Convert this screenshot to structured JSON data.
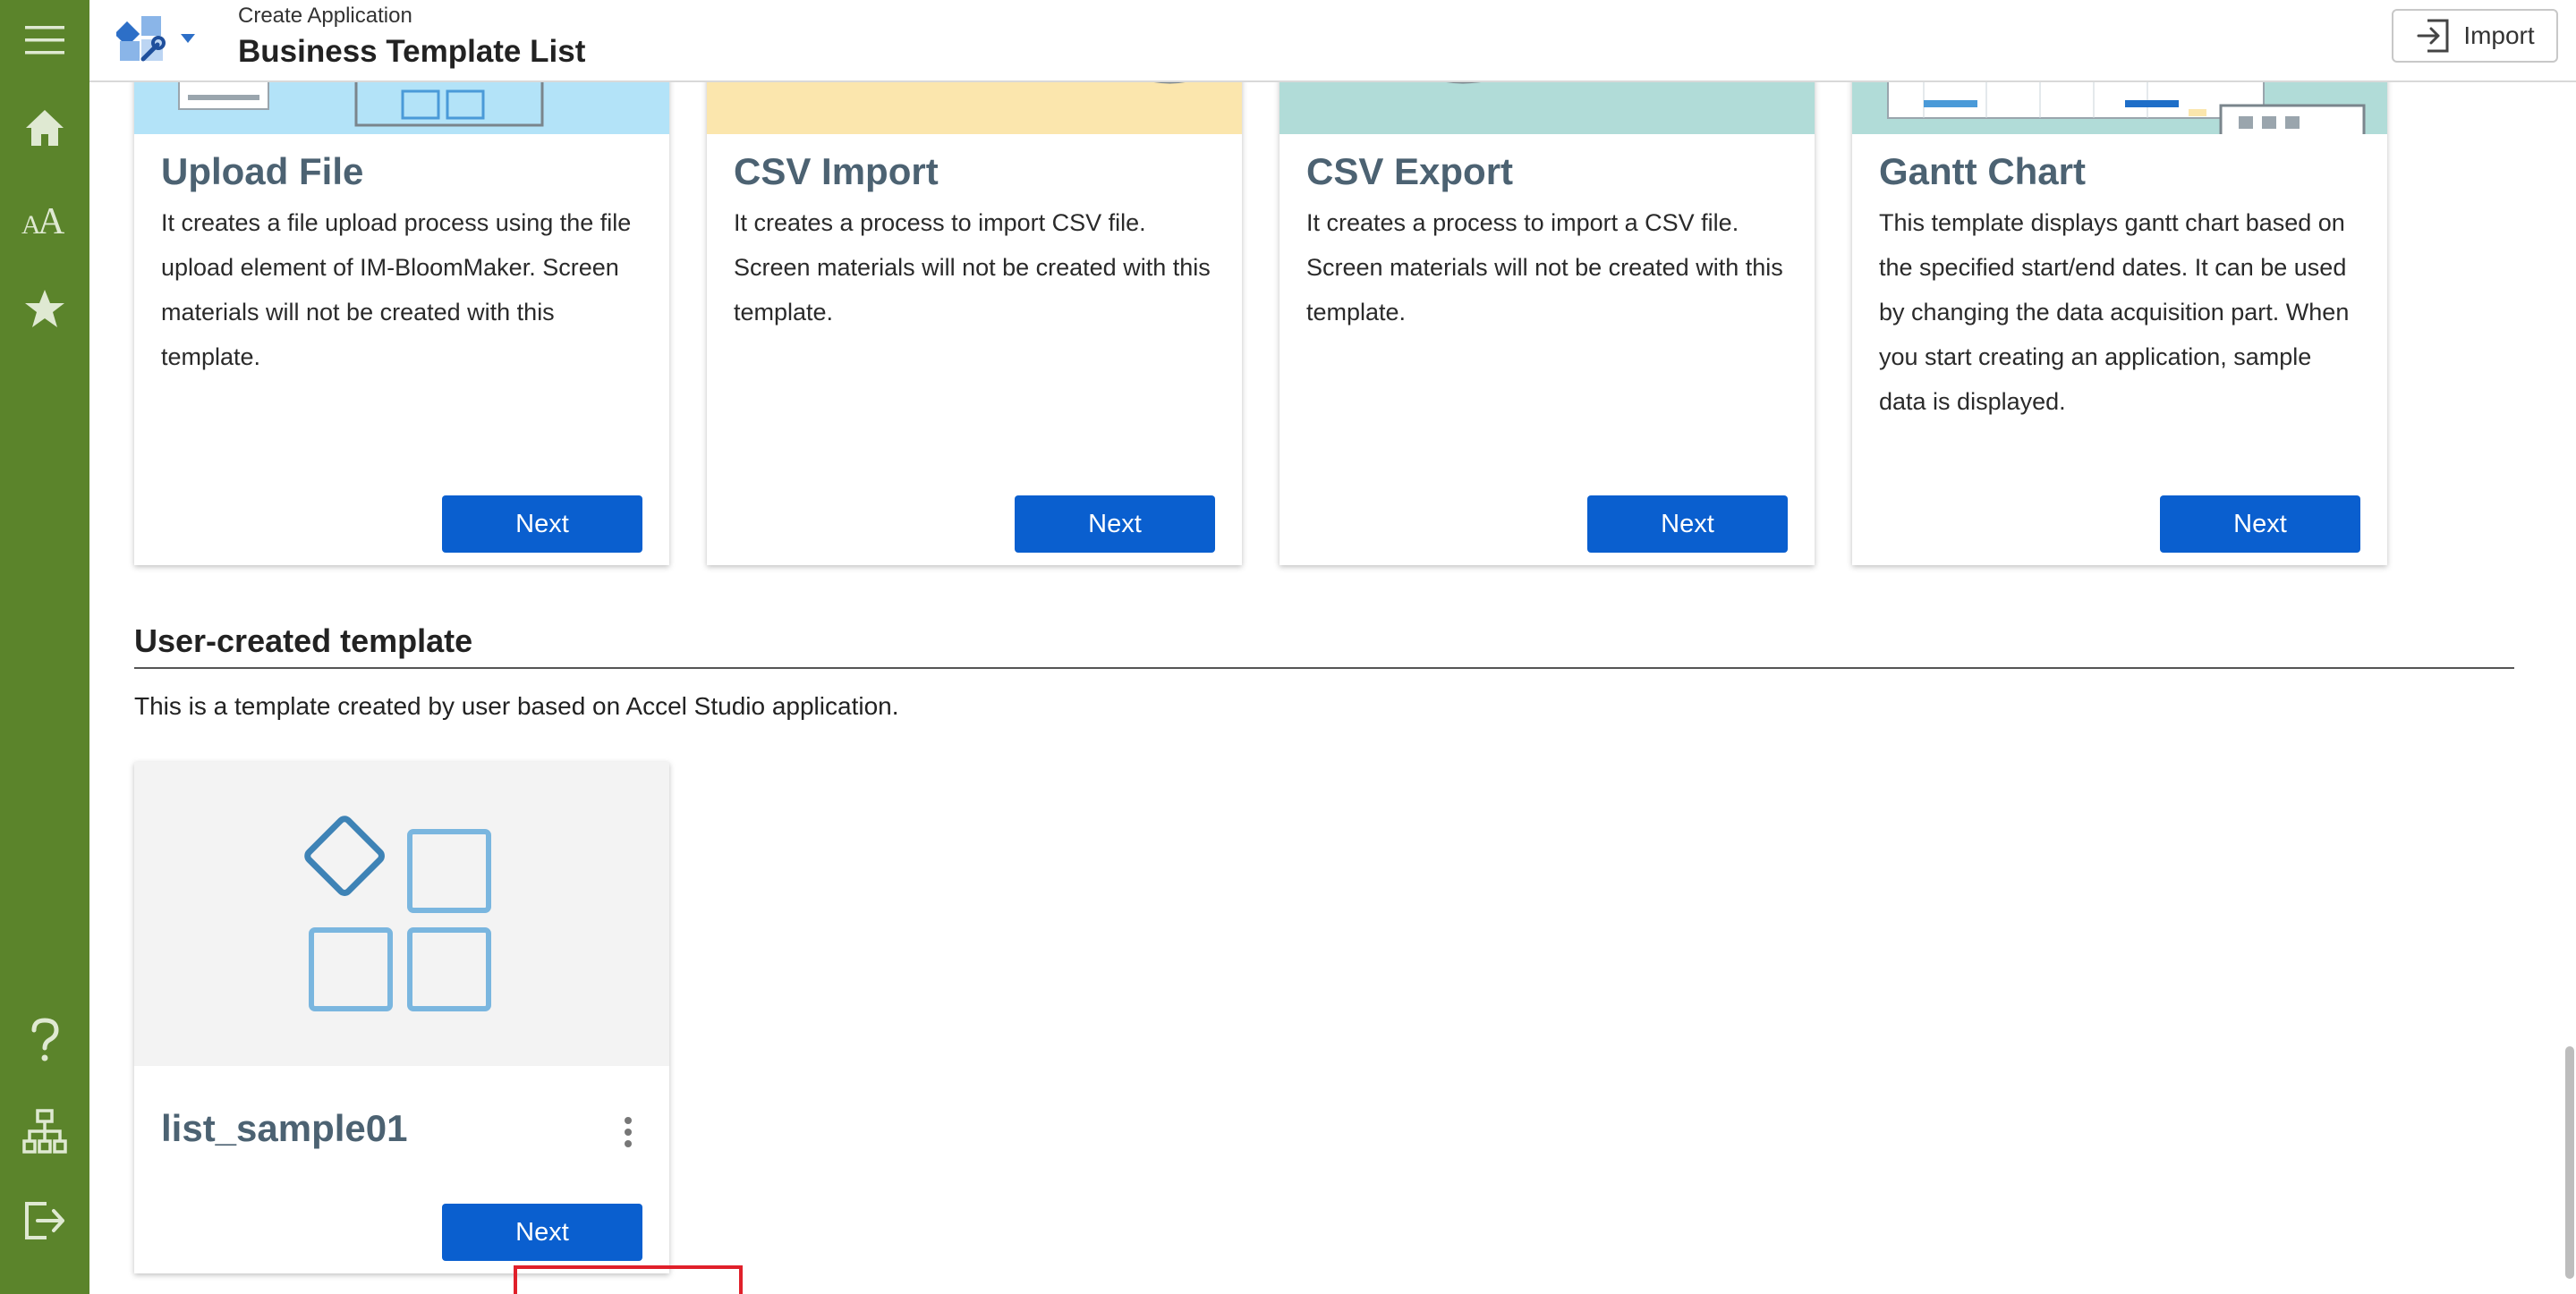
{
  "header": {
    "subtitle": "Create Application",
    "title": "Business Template List",
    "import_label": "Import"
  },
  "sidebar": {
    "items": [
      {
        "name": "menu-icon"
      },
      {
        "name": "home-icon"
      },
      {
        "name": "font-size-icon"
      },
      {
        "name": "star-icon"
      },
      {
        "name": "help-icon"
      },
      {
        "name": "sitemap-icon"
      },
      {
        "name": "logout-icon"
      }
    ]
  },
  "cards": [
    {
      "title": "Upload File",
      "description": "It creates a file upload process using the file upload element of IM-BloomMaker. Screen materials will not be created with this template.",
      "button": "Next",
      "thumb_color": "#b3e3f8"
    },
    {
      "title": "CSV Import",
      "description": "It creates a process to import CSV file. Screen materials will not be created with this template.",
      "button": "Next",
      "thumb_color": "#fbe6ad"
    },
    {
      "title": "CSV Export",
      "description": "It creates a process to import a CSV file. Screen materials will not be created with this template.",
      "button": "Next",
      "thumb_color": "#b1dcd8"
    },
    {
      "title": "Gantt Chart",
      "description": "This template displays gantt chart based on the specified start/end dates. It can be used by changing the data acquisition part. When you start creating an application, sample data is displayed.",
      "button": "Next",
      "thumb_color": "#b1dcd8"
    }
  ],
  "user_section": {
    "title": "User-created template",
    "description": "This is a template created by user based on Accel Studio application."
  },
  "user_cards": [
    {
      "title": "list_sample01",
      "button": "Next",
      "thumb_color": "#f3f3f3"
    }
  ],
  "colors": {
    "sidebar": "#5b842b",
    "primary_button": "#0a5fcf",
    "highlight": "#e0202a"
  }
}
